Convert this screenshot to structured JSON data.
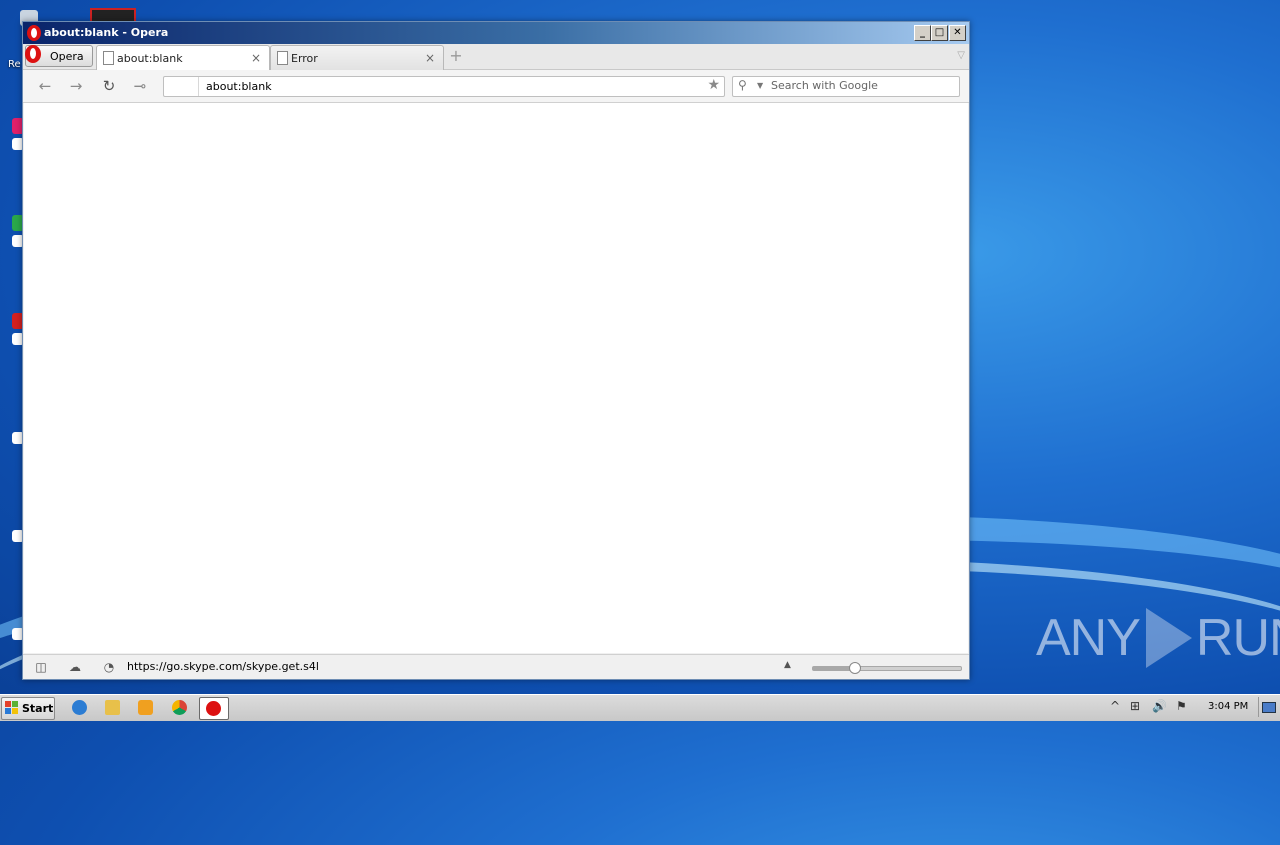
{
  "window": {
    "title": "about:blank - Opera",
    "controls": {
      "minimize": "_",
      "maximize": "□",
      "close": "✕"
    }
  },
  "tabbar": {
    "menu_label": "Opera",
    "tabs": [
      {
        "label": "about:blank",
        "active": true,
        "close": "×"
      },
      {
        "label": "Error",
        "active": false,
        "close": "×"
      }
    ],
    "new_tab": "+",
    "tab_menu": "▽"
  },
  "navbar": {
    "back_icon": "←",
    "forward_icon": "→",
    "reload_icon": "↻",
    "key_icon": "⊸",
    "address_value": "about:blank",
    "bookmark_icon": "★",
    "search_placeholder": "Search with Google",
    "search_icon": "⚲",
    "search_dropdown": "▼"
  },
  "statusbar": {
    "panel_icon": "◫",
    "cloud_icon": "☁",
    "speed_icon": "◔",
    "url": "https://go.skype.com/skype.get.s4l",
    "zoom_arrow": "▲",
    "zoom_level": 0.28
  },
  "desktop": {
    "watermark_left": "ANY",
    "watermark_right": "RUN",
    "icon_labels": [
      "Re"
    ]
  },
  "taskbar": {
    "start_label": "Start",
    "apps": [
      "internet-explorer-icon",
      "file-explorer-icon",
      "media-player-icon",
      "chrome-icon",
      "opera-icon"
    ],
    "tray_icons": [
      "^",
      "⊞",
      "🔊",
      "⚑"
    ],
    "clock": "3:04 PM"
  },
  "colors": {
    "title_gradient_start": "#0a246a",
    "opera_red": "#d11111",
    "desktop_blue": "#1f6fd0"
  }
}
